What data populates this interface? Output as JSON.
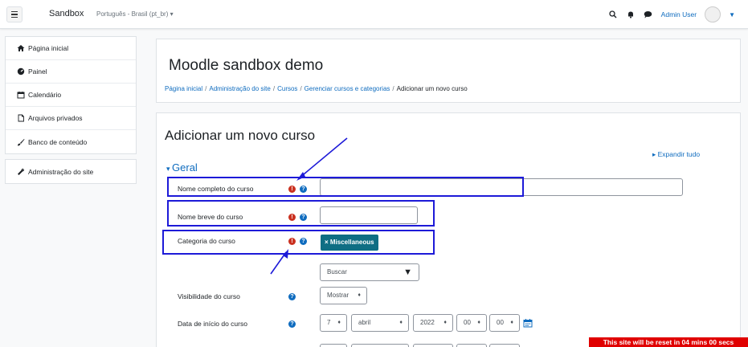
{
  "navbar": {
    "brand": "Sandbox",
    "language": "Português - Brasil (pt_br) ▾",
    "user_name": "Admin User",
    "icons": [
      "menu-icon",
      "search-icon",
      "bell-icon",
      "chat-icon",
      "avatar",
      "chevron-down-icon"
    ]
  },
  "sidebar": {
    "group1": [
      {
        "label": "Página inicial",
        "icon": "home-icon"
      },
      {
        "label": "Painel",
        "icon": "dashboard-icon"
      },
      {
        "label": "Calendário",
        "icon": "calendar-icon"
      },
      {
        "label": "Arquivos privados",
        "icon": "file-icon"
      },
      {
        "label": "Banco de conteúdo",
        "icon": "brush-icon"
      }
    ],
    "group2": [
      {
        "label": "Administração do site",
        "icon": "wrench-icon"
      }
    ]
  },
  "header": {
    "title": "Moodle sandbox demo",
    "breadcrumb": [
      "Página inicial",
      "Administração do site",
      "Cursos",
      "Gerenciar cursos e categorias",
      "Adicionar um novo curso"
    ]
  },
  "form": {
    "title": "Adicionar um novo curso",
    "expand_all": "Expandir tudo",
    "section": "Geral",
    "fields": {
      "fullname_label": "Nome completo do curso",
      "fullname_value": "",
      "shortname_label": "Nome breve do curso",
      "shortname_value": "",
      "category_label": "Categoria do curso",
      "category_tag": "× Miscellaneous",
      "search_label": "Buscar",
      "visibility_label": "Visibilidade do curso",
      "visibility_value": "Mostrar",
      "startdate_label": "Data de início do curso",
      "start_day": "7",
      "start_month": "abril",
      "start_year": "2022",
      "start_hour": "00",
      "start_minute": "00"
    }
  },
  "banner": {
    "text": "This site will be reset in 04 mins 00 secs"
  },
  "colors": {
    "accent": "#0f6cbf",
    "required": "#ca3120",
    "tag": "#0f6e84",
    "annotation": "#1d1ad8",
    "banner": "#e00000"
  }
}
